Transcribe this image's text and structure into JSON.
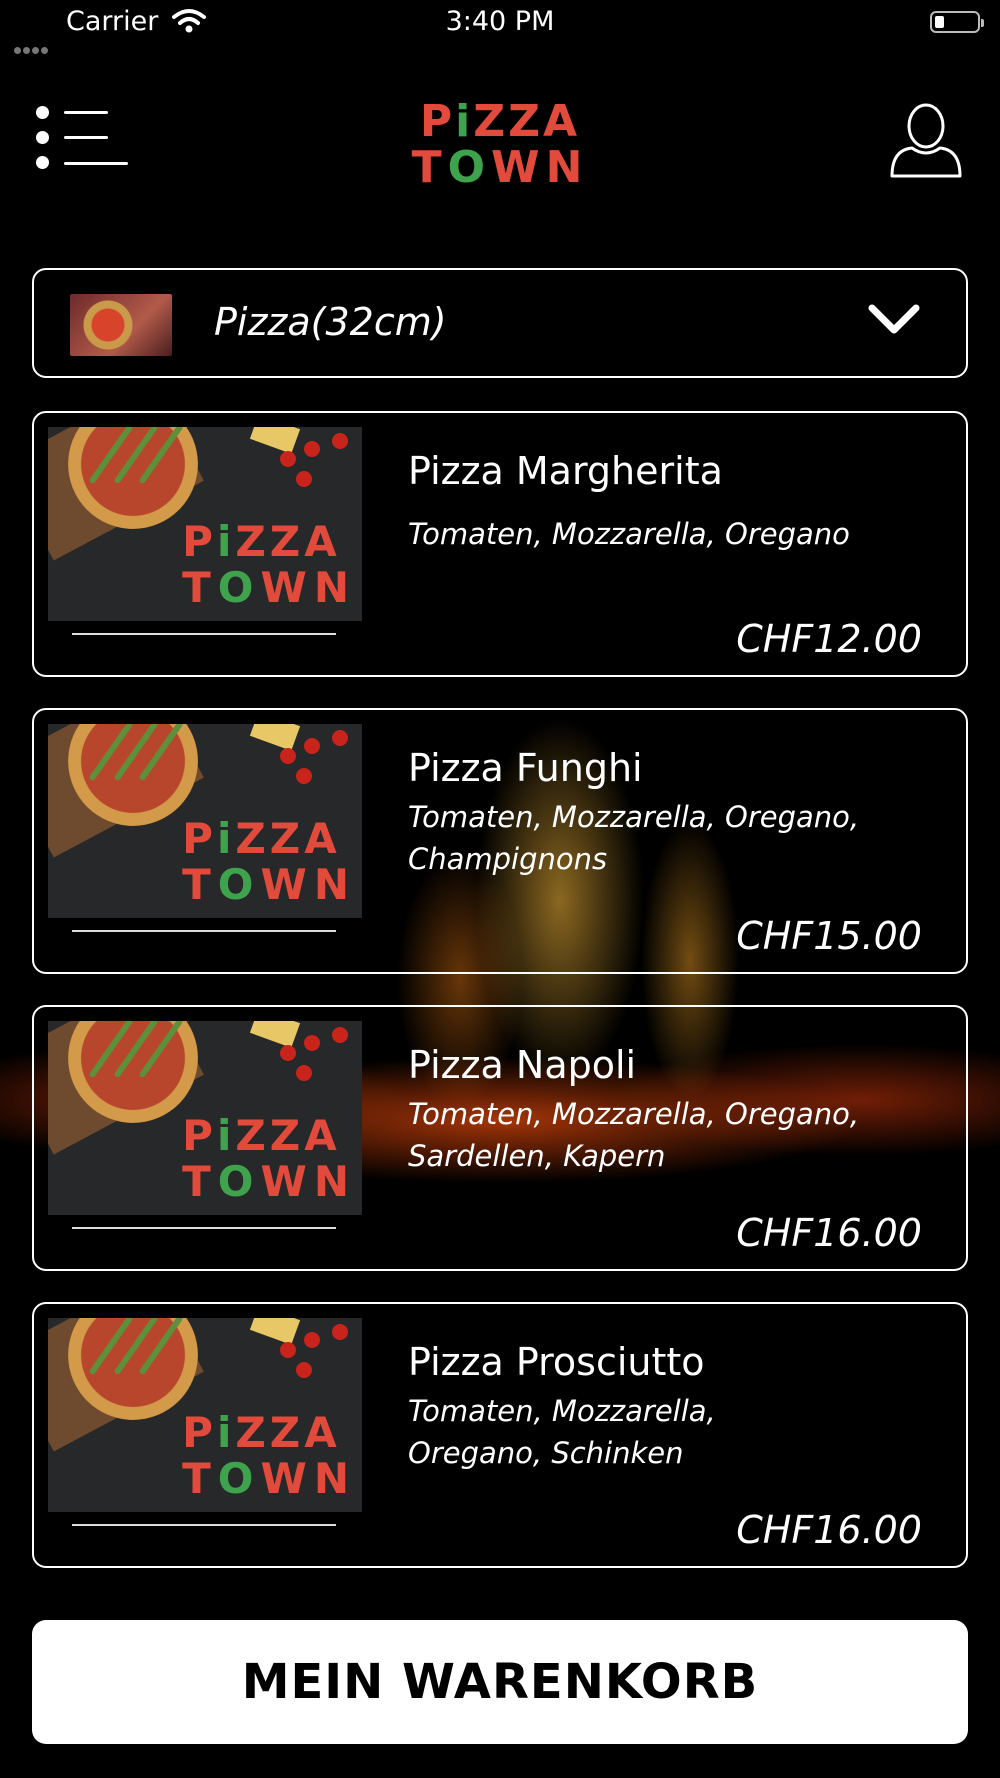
{
  "status_bar": {
    "carrier": "Carrier",
    "time": "3:40 PM"
  },
  "header": {
    "logo_line1_first": "P",
    "logo_line1_i": "i",
    "logo_line1_rest": "ZZA",
    "logo_line2_t": "T",
    "logo_line2_o": "O",
    "logo_line2_rest": "WN",
    "menu_icon": "hamburger-menu-icon",
    "profile_icon": "user-profile-icon"
  },
  "category": {
    "label": "Pizza(32cm)",
    "icon": "chevron-down-icon"
  },
  "products": [
    {
      "name": "Pizza Margherita",
      "description": "Tomaten, Mozzarella, Oregano",
      "price": "CHF12.00"
    },
    {
      "name": "Pizza Funghi",
      "description": "Tomaten, Mozzarella, Oregano, Champignons",
      "price": "CHF15.00"
    },
    {
      "name": "Pizza Napoli",
      "description": "Tomaten, Mozzarella, Oregano, Sardellen, Kapern",
      "price": "CHF16.00"
    },
    {
      "name": "Pizza Prosciutto",
      "description": "Tomaten, Mozzarella, Oregano, Schinken",
      "price": "CHF16.00"
    }
  ],
  "product_image_brand": {
    "line1_first": "P",
    "line1_i": "i",
    "line1_rest": "ZZA",
    "line2_t": "T",
    "line2_o": "O",
    "line2_rest": "WN"
  },
  "cart_button": {
    "label": "MEIN WARENKORB"
  },
  "colors": {
    "brand_red": "#e24a3b",
    "brand_green": "#3fa34d",
    "background": "#000000",
    "button_bg": "#ffffff"
  }
}
